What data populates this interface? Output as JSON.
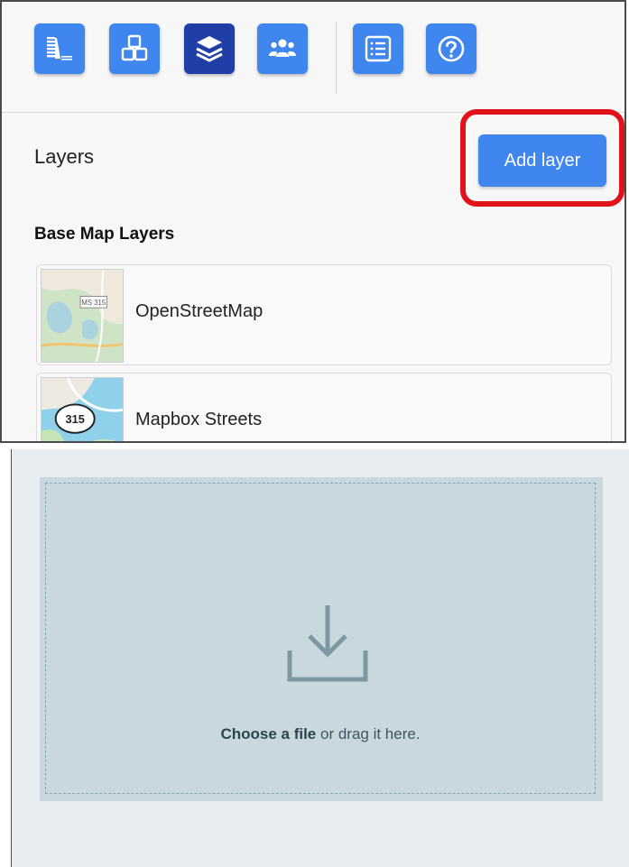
{
  "toolbar": {
    "buttons": [
      {
        "icon": "legend-icon"
      },
      {
        "icon": "cubes-icon"
      },
      {
        "icon": "layers-icon",
        "active": true
      },
      {
        "icon": "users-icon"
      },
      {
        "icon": "list-icon"
      },
      {
        "icon": "help-icon"
      }
    ]
  },
  "layers_panel": {
    "title": "Layers",
    "add_button_label": "Add layer",
    "section_title": "Base Map Layers",
    "items": [
      {
        "label": "OpenStreetMap",
        "thumb_text": "MS 315"
      },
      {
        "label": "Mapbox Streets",
        "thumb_text": "315"
      }
    ]
  },
  "upload": {
    "choose_link": "Choose a file",
    "suffix": " or drag it here."
  },
  "colors": {
    "button_blue": "#3f87ee",
    "button_active": "#1f3ea6",
    "highlight_red": "#e11219",
    "dropzone_bg": "#c8d8de"
  }
}
